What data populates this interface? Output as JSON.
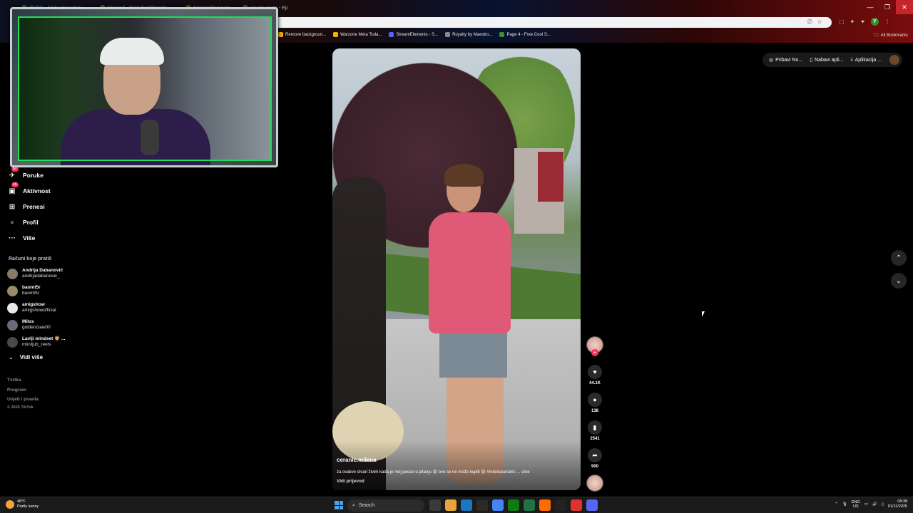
{
  "browser": {
    "tabs": [
      {
        "label": "TikTok - Make Your Day"
      },
      {
        "label": "Discord - Gain Dashboard"
      },
      {
        "label": "StreamElements"
      },
      {
        "label": "Hayley Kate - Ep"
      }
    ],
    "window_controls": {
      "minimize": "—",
      "restore": "❐",
      "close": "✕"
    },
    "bookmarks": [
      {
        "label": "Remove backgroun...",
        "color": "#f4b400"
      },
      {
        "label": "Warzone Meta Toda...",
        "color": "#f4b400"
      },
      {
        "label": "StreamElements - S...",
        "color": "#5865f2"
      },
      {
        "label": "Royalty by Maestro...",
        "color": "#888888"
      },
      {
        "label": "Page 4 - Free Cool S...",
        "color": "#3f8f2f"
      }
    ],
    "all_bookmarks": "All Bookmarks",
    "profile_initial": "Y"
  },
  "sidebar": {
    "items": [
      {
        "label": "Poruke",
        "icon": "send-icon",
        "glyph": "✈",
        "badge": "57"
      },
      {
        "label": "Aktivnost",
        "icon": "inbox-icon",
        "glyph": "▣",
        "badge": "15"
      },
      {
        "label": "Prenesi",
        "icon": "plus-icon",
        "glyph": "⊞",
        "badge": ""
      },
      {
        "label": "Profil",
        "icon": "profile-icon",
        "glyph": "●",
        "badge": ""
      },
      {
        "label": "Više",
        "icon": "more-icon",
        "glyph": "···",
        "badge": ""
      }
    ],
    "following_title": "Računi koje pratiš",
    "accounts": [
      {
        "name": "Andrija Dabanović",
        "handle": "andrijadabanovic_",
        "color": "#8a7a6a"
      },
      {
        "name": "baomt5r",
        "handle": "baomt5r",
        "color": "#9a8a6a"
      },
      {
        "name": "amigshow",
        "handle": "amigshowofficial",
        "color": "#e8e8e8"
      },
      {
        "name": "Milos",
        "handle": "goldenclaw00",
        "color": "#6a6a7a"
      },
      {
        "name": "Lavlji mindset 🦁 ...",
        "handle": "miroljub_reels",
        "color": "#4a4a4a"
      }
    ],
    "see_more": "Vidi više",
    "footer": [
      "Tvrtka",
      "Program",
      "Uvjeti i pravila",
      "© 2025 TikTok"
    ]
  },
  "video": {
    "author": "ceranic.milena",
    "caption": "za ovakve stvari živim kada je moj posao u pitanju 😍 ovo se ne može kupiti 😍 #milenaceranic ...",
    "caption_more": "više",
    "translate": "Vidi prijevod"
  },
  "actions": {
    "likes": "44.1K",
    "comments": "138",
    "saves": "2541",
    "shares": "900"
  },
  "topright": {
    "get_coins": "Pribavi No...",
    "get_app": "Nabavi apli...",
    "app": "Aplikacija ..."
  },
  "taskbar": {
    "temperature": "48°F",
    "weather": "Partly sunny",
    "search": "Search",
    "lang1": "ENG",
    "lang2": "US",
    "time": "08:38",
    "date": "01/11/2025",
    "apps": [
      "#3a3a3a",
      "#e8a33a",
      "#1a78c2",
      "#2a2a2a",
      "#4285f4",
      "#107c10",
      "#217346",
      "#ff6a00",
      "#222222",
      "#e03030",
      "#5865f2"
    ]
  }
}
